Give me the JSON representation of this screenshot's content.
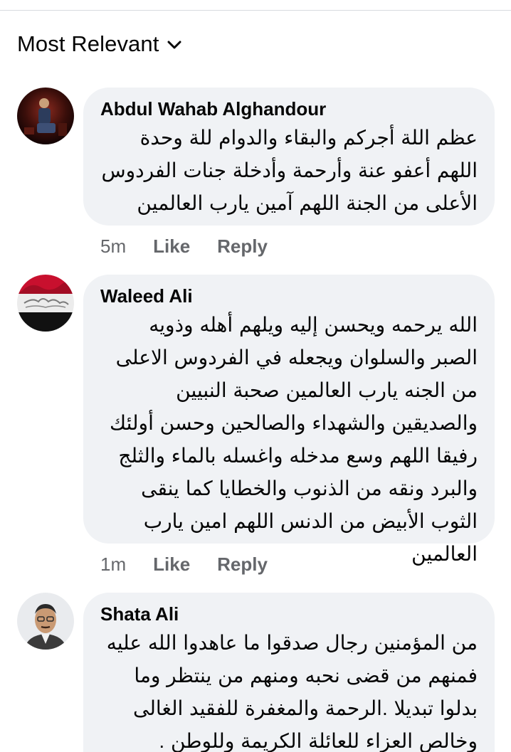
{
  "sort": {
    "label": "Most Relevant",
    "icon": "chevron-down-icon"
  },
  "comments": [
    {
      "author": "Abdul Wahab Alghandour",
      "text": "عظم اللة أجركم والبقاء والدوام للة وحدة اللهم أعفو عنة وأرحمة وأدخلة جنات الفردوس الأعلى من الجنة اللهم آمين يارب العالمين",
      "time": "5m",
      "like": "Like",
      "reply": "Reply"
    },
    {
      "author": "Waleed Ali",
      "text": "الله يرحمه ويحسن إليه ويلهم أهله وذويه الصبر والسلوان ويجعله في الفردوس الاعلى من الجنه يارب العالمين صحبة النبيين والصديقين والشهداء والصالحين وحسن أولئك رفيقا اللهم وسع مدخله واغسله بالماء والثلج والبرد ونقه من الذنوب والخطايا كما ينقى الثوب الأبيض من الدنس اللهم امين يارب العالمين",
      "time": "1m",
      "like": "Like",
      "reply": "Reply"
    },
    {
      "author": "Shata Ali",
      "text": "من المؤمنين رجال صدقوا ما عاهدوا الله عليه فمنهم من قضى نحبه ومنهم من ينتظر وما بدلوا تبديلا .الرحمة والمغفرة للفقيد الغالى وخالص العزاء للعائلة الكريمة وللوطن .",
      "time": "",
      "like": "",
      "reply": ""
    }
  ],
  "colors": {
    "bubble": "#f0f2f5",
    "meta": "#65676b",
    "text": "#050505"
  }
}
